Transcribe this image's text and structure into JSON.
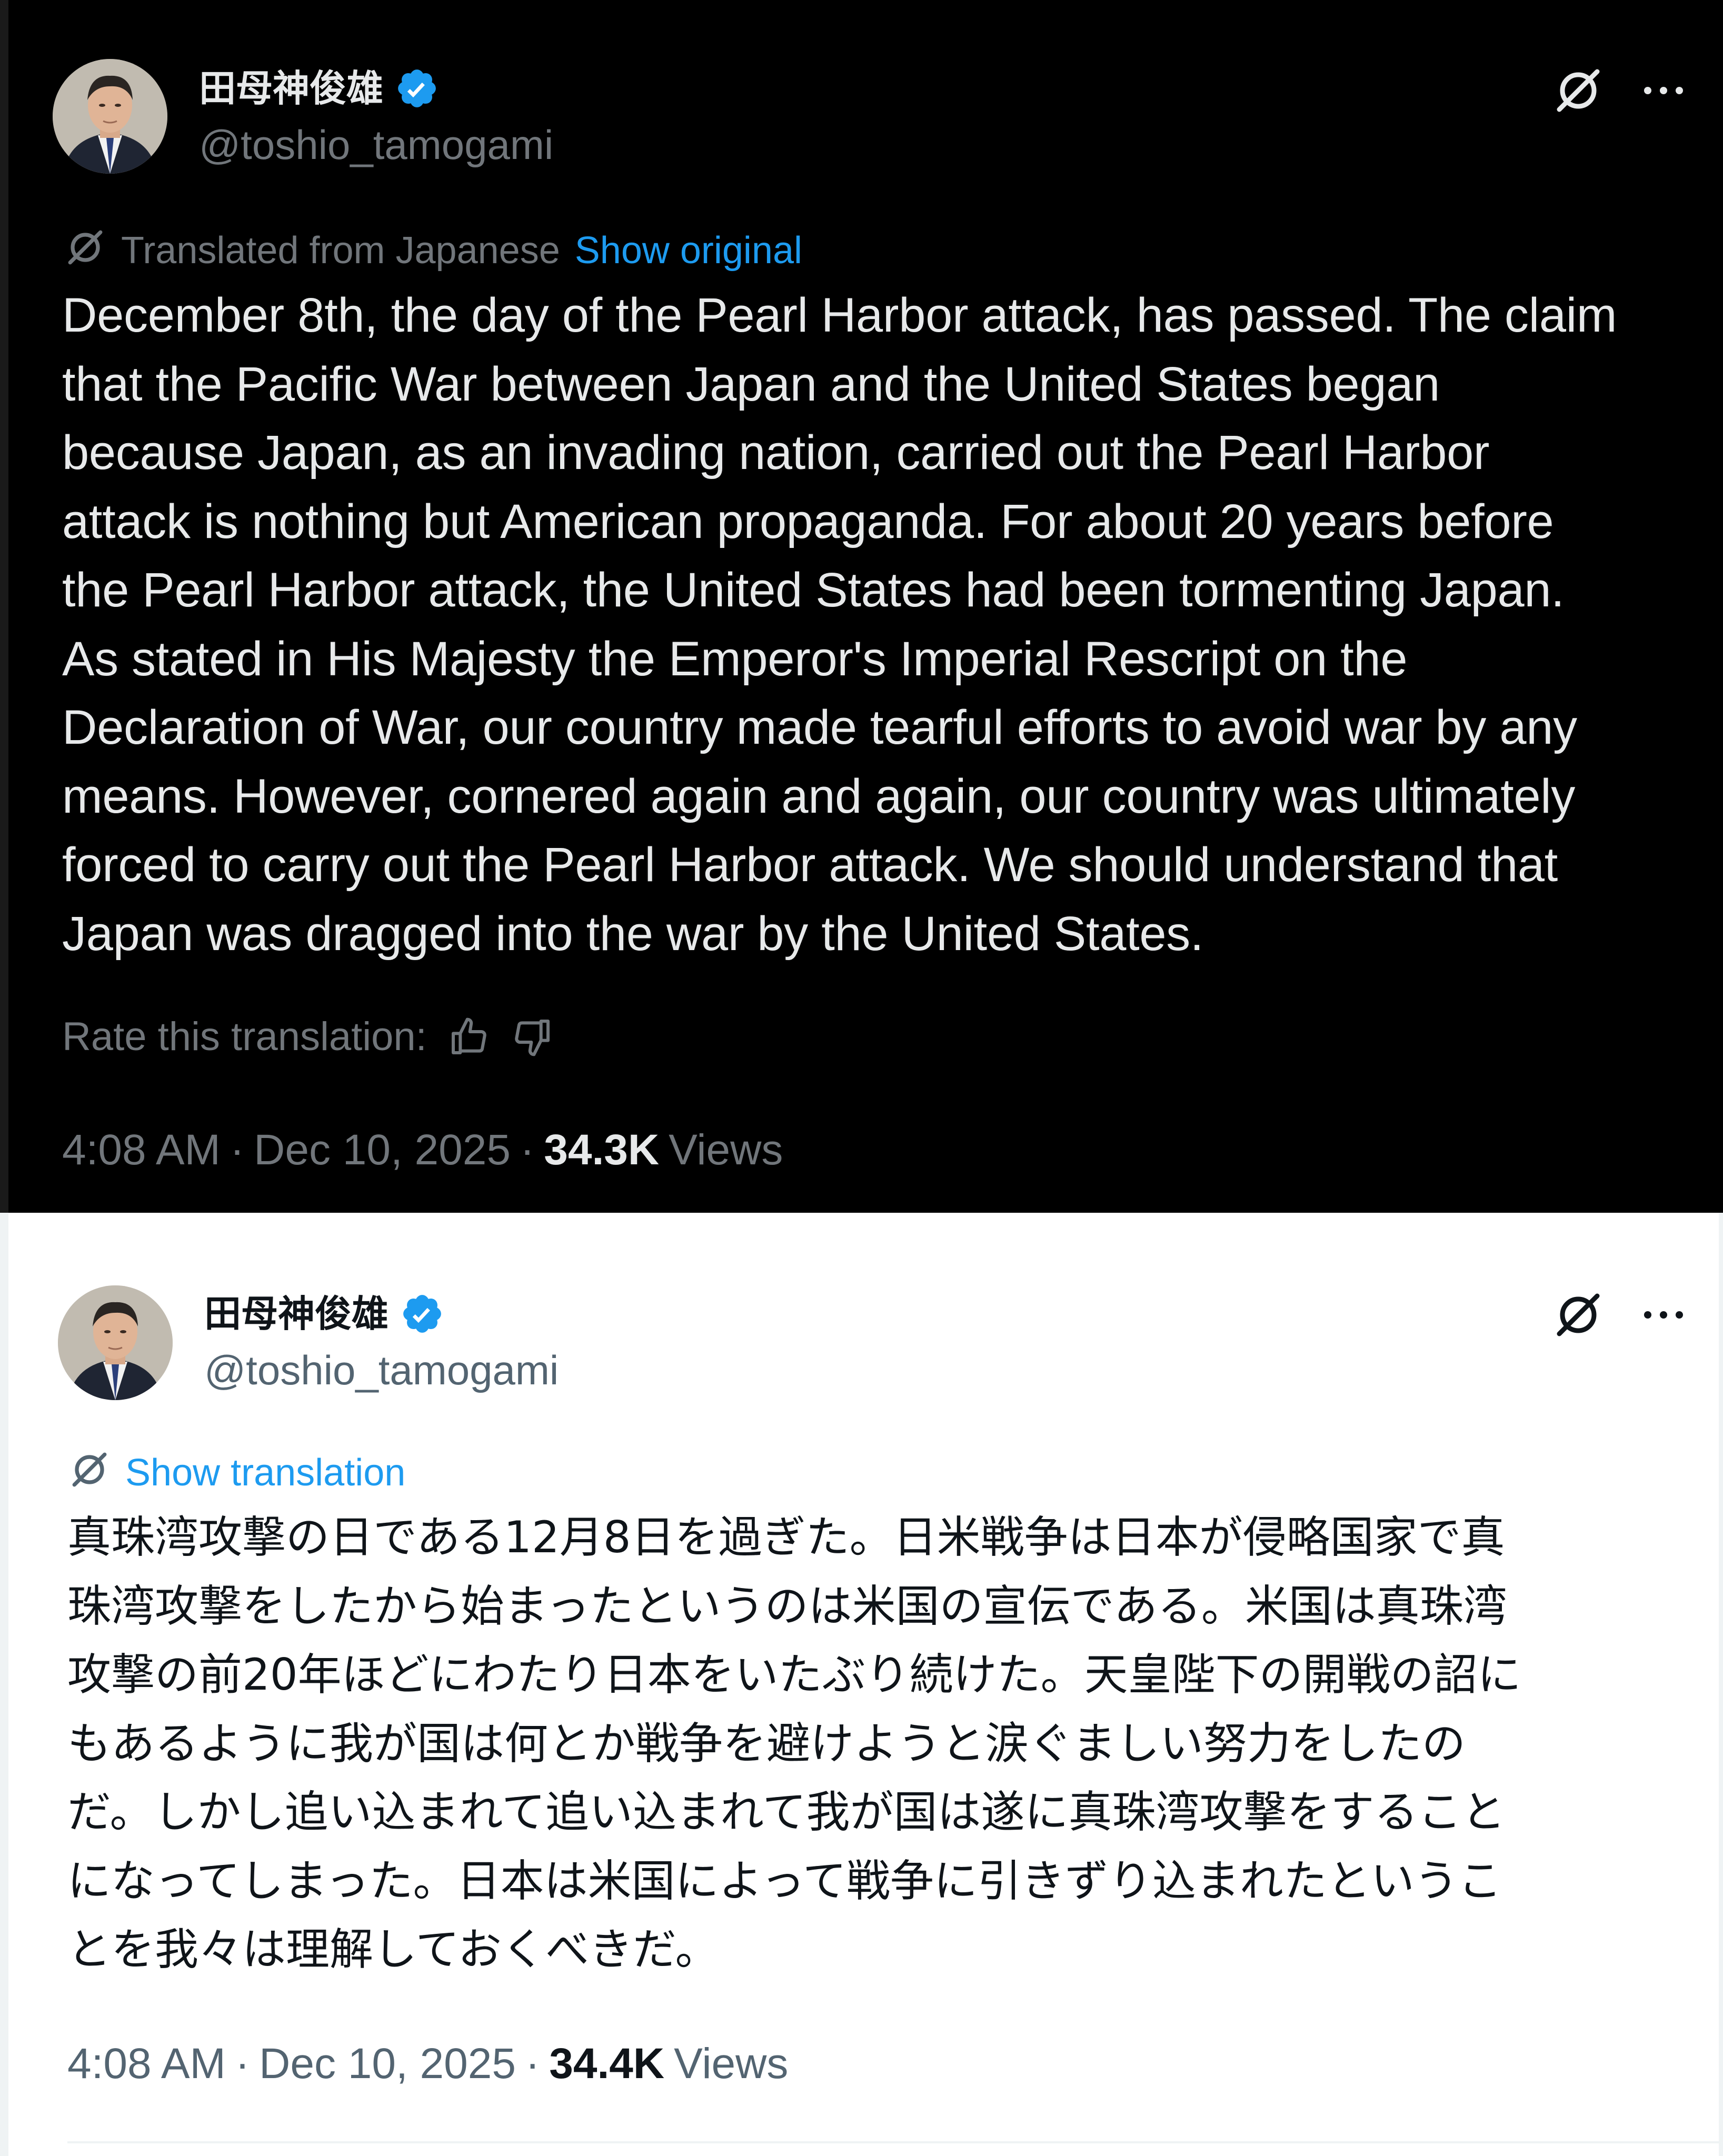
{
  "accent_color": "#1d9bf0",
  "posts": [
    {
      "theme": "dark",
      "author": {
        "display_name": "田母神俊雄",
        "handle": "@toshio_tamogami",
        "verified_icon": "verified-badge-icon",
        "avatar": "profile-photo"
      },
      "translation": {
        "label": "Translated from Japanese",
        "toggle": "Show original"
      },
      "body": "December 8th, the day of the Pearl Harbor attack, has passed. The claim\nthat the Pacific War between Japan and the United States began\nbecause Japan, as an invading nation, carried out the Pearl Harbor\nattack is nothing but American propaganda. For about 20 years before\nthe Pearl Harbor attack, the United States had been tormenting Japan.\nAs stated in His Majesty the Emperor's Imperial Rescript on the\nDeclaration of War, our country made tearful efforts to avoid war by any\nmeans. However, cornered again and again, our country was ultimately\nforced to carry out the Pearl Harbor attack. We should understand that\nJapan was dragged into the war by the United States.",
      "rate": {
        "label": "Rate this translation:",
        "up_icon": "thumbs-up-icon",
        "down_icon": "thumbs-down-icon"
      },
      "meta": {
        "time": "4:08 AM",
        "date": "Dec 10, 2025",
        "views_count": "34.3K",
        "views_label": "Views"
      }
    },
    {
      "theme": "light",
      "author": {
        "display_name": "田母神俊雄",
        "handle": "@toshio_tamogami",
        "verified_icon": "verified-badge-icon",
        "avatar": "profile-photo"
      },
      "translation": {
        "toggle": "Show translation"
      },
      "body": "真珠湾攻撃の日である12月8日を過ぎた。日米戦争は日本が侵略国家で真\n珠湾攻撃をしたから始まったというのは米国の宣伝である。米国は真珠湾\n攻撃の前20年ほどにわたり日本をいたぶり続けた。天皇陛下の開戦の詔に\nもあるように我が国は何とか戦争を避けようと涙ぐましい努力をしたの\nだ。しかし追い込まれて追い込まれて我が国は遂に真珠湾攻撃をすること\nになってしまった。日本は米国によって戦争に引きずり込まれたというこ\nとを我々は理解しておくべきだ。",
      "meta": {
        "time": "4:08 AM",
        "date": "Dec 10, 2025",
        "views_count": "34.4K",
        "views_label": "Views"
      }
    }
  ],
  "top_actions": {
    "grok_icon": "grok-icon",
    "more_icon": "more-options-icon"
  }
}
